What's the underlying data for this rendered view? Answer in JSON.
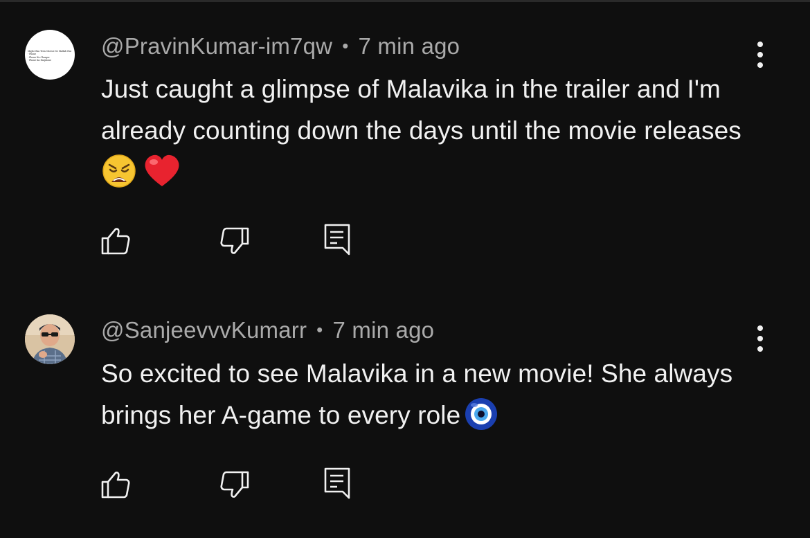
{
  "comments": [
    {
      "author": "@PravinKumar-im7qw",
      "separator": "•",
      "time": "7 min ago",
      "text": "Just caught a glimpse of Malavika in the trailer and I'm already counting down the days until the movie releases",
      "emojis": [
        "weary-face",
        "red-heart"
      ],
      "avatar_text": "Mujhe Bas Teen Cheeze Se Matlab Hai\n- Phone\n- Phone Ka Charger\n- Phone Ka Earphone"
    },
    {
      "author": "@SanjeevvvKumarr",
      "separator": "•",
      "time": "7 min ago",
      "text": "So excited to see Malavika in a new movie! She always brings her A-game to every role",
      "emojis": [
        "nazar-amulet"
      ]
    }
  ],
  "actions": [
    "like-icon",
    "dislike-icon",
    "reply-icon"
  ],
  "colors": {
    "background": "#0f0f0f",
    "text": "#f1f1f1",
    "meta": "#aaaaaa"
  }
}
